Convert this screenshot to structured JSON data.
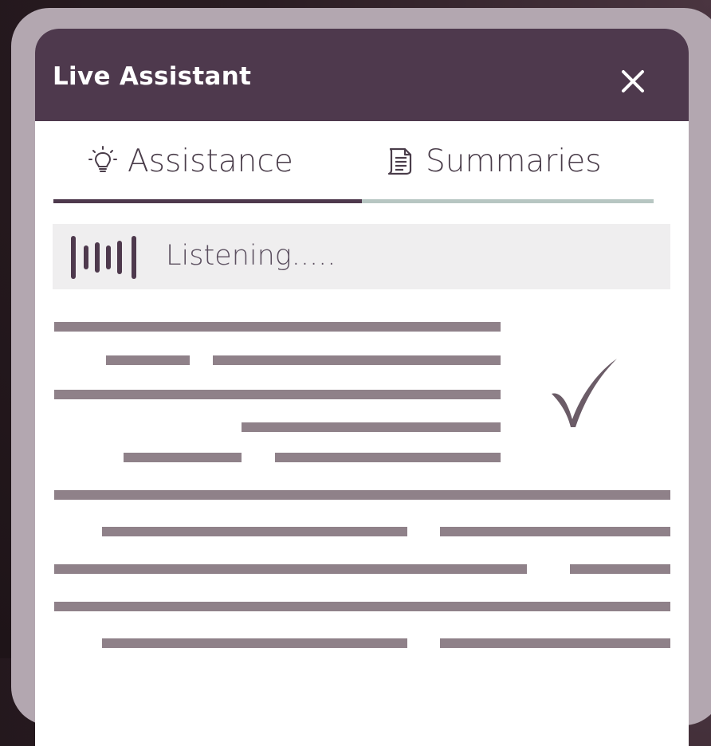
{
  "header": {
    "title": "Live Assistant",
    "close_icon": "close-icon"
  },
  "tabs": [
    {
      "label": "Assistance",
      "icon": "lightbulb-icon",
      "active": true
    },
    {
      "label": "Summaries",
      "icon": "document-icon",
      "active": false
    }
  ],
  "status": {
    "text": "Listening.....",
    "icon": "waveform-icon"
  },
  "content": {
    "placeholder_lines": 20,
    "check_icon": "checkmark-icon"
  },
  "colors": {
    "header_bg": "#4e394d",
    "device_frame": "#b3a7b0",
    "active_tab_underline": "#4e394d",
    "inactive_tab_underline": "#b7c6c2",
    "status_bg": "#efeeef",
    "placeholder_line": "#8f8189"
  }
}
